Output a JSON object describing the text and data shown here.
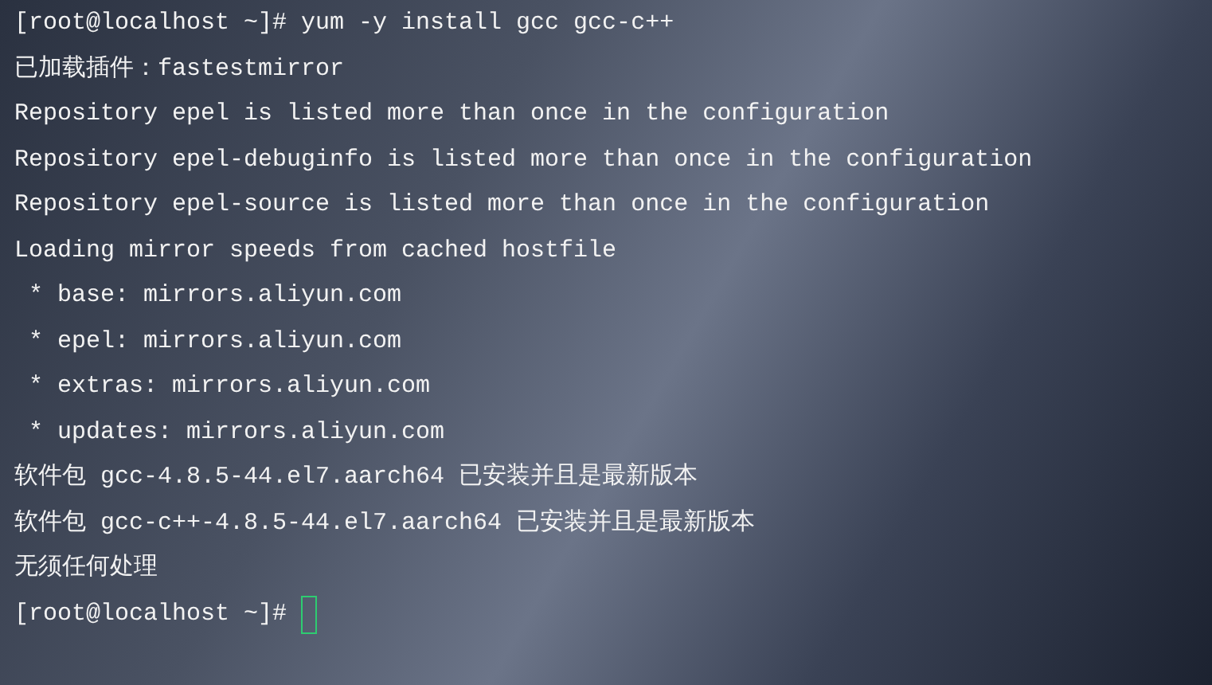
{
  "terminal": {
    "lines": [
      {
        "text": "[root@localhost ~]# yum -y install gcc gcc-c++"
      },
      {
        "text": "已加载插件：fastestmirror"
      },
      {
        "text": "Repository epel is listed more than once in the configuration"
      },
      {
        "text": "Repository epel-debuginfo is listed more than once in the configuration"
      },
      {
        "text": "Repository epel-source is listed more than once in the configuration"
      },
      {
        "text": "Loading mirror speeds from cached hostfile"
      },
      {
        "text": " * base: mirrors.aliyun.com"
      },
      {
        "text": " * epel: mirrors.aliyun.com"
      },
      {
        "text": " * extras: mirrors.aliyun.com"
      },
      {
        "text": " * updates: mirrors.aliyun.com"
      },
      {
        "text": "软件包 gcc-4.8.5-44.el7.aarch64 已安装并且是最新版本"
      },
      {
        "text": "软件包 gcc-c++-4.8.5-44.el7.aarch64 已安装并且是最新版本"
      },
      {
        "text": "无须任何处理"
      }
    ],
    "prompt": {
      "text": "[root@localhost ~]#",
      "cursor": true
    }
  }
}
